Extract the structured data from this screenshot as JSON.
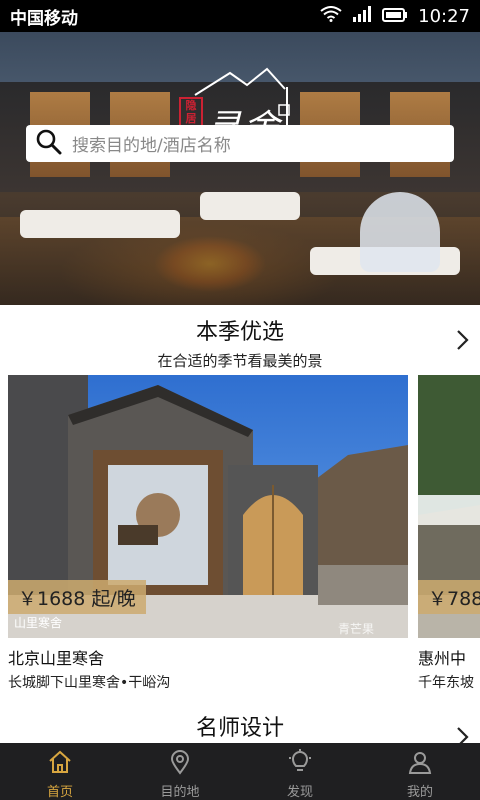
{
  "status_bar": {
    "carrier": "中国移动",
    "time": "10:27"
  },
  "hero": {
    "logo_text": "寻舍",
    "seal_text": "隐居",
    "search_placeholder": "搜索目的地/酒店名称"
  },
  "sections": [
    {
      "title": "本季优选",
      "subtitle": "在合适的季节看最美的景"
    },
    {
      "title": "名师设计"
    }
  ],
  "cards": [
    {
      "price": "￥1688 起/晚",
      "name": "北京山里寒舍",
      "desc": "长城脚下山里寒舍•干峪沟",
      "watermark": "青芒果",
      "brand": "山里寒舍"
    },
    {
      "price": "￥788",
      "name": "惠州中",
      "desc": "千年东坡"
    }
  ],
  "tabs": [
    {
      "label": "首页",
      "icon": "home-icon",
      "active": true
    },
    {
      "label": "目的地",
      "icon": "location-pin-icon",
      "active": false
    },
    {
      "label": "发现",
      "icon": "lightbulb-icon",
      "active": false
    },
    {
      "label": "我的",
      "icon": "user-icon",
      "active": false
    }
  ],
  "colors": {
    "accent": "#d8a640",
    "tabbar_bg": "#1f1f21",
    "price_tag_bg": "#cdaa6e"
  }
}
